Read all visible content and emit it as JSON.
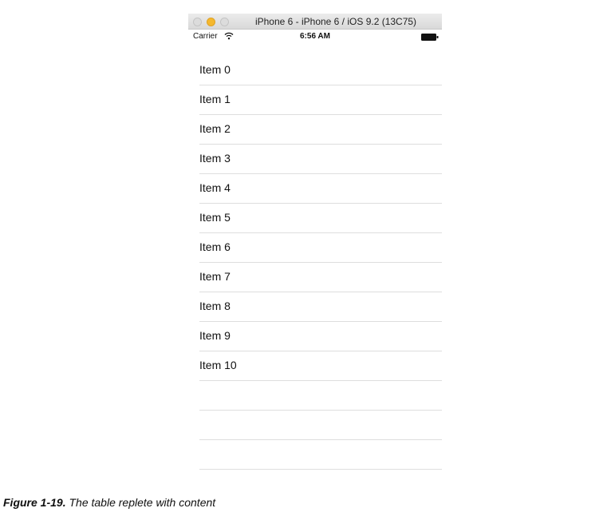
{
  "window": {
    "title": "iPhone 6 - iPhone 6 / iOS 9.2 (13C75)",
    "controls": [
      "close-icon",
      "minimize-icon",
      "zoom-icon"
    ],
    "minimize_color": "#f5b82e"
  },
  "status_bar": {
    "carrier": "Carrier",
    "time": "6:56 AM",
    "icons": [
      "wifi-icon",
      "battery-icon"
    ]
  },
  "table": {
    "rows": [
      {
        "label": "Item 0"
      },
      {
        "label": "Item 1"
      },
      {
        "label": "Item 2"
      },
      {
        "label": "Item 3"
      },
      {
        "label": "Item 4"
      },
      {
        "label": "Item 5"
      },
      {
        "label": "Item 6"
      },
      {
        "label": "Item 7"
      },
      {
        "label": "Item 8"
      },
      {
        "label": "Item 9"
      },
      {
        "label": "Item 10"
      },
      {
        "label": ""
      },
      {
        "label": ""
      },
      {
        "label": ""
      }
    ]
  },
  "caption": {
    "number": "Figure 1-19.",
    "text": "The table replete with content"
  }
}
